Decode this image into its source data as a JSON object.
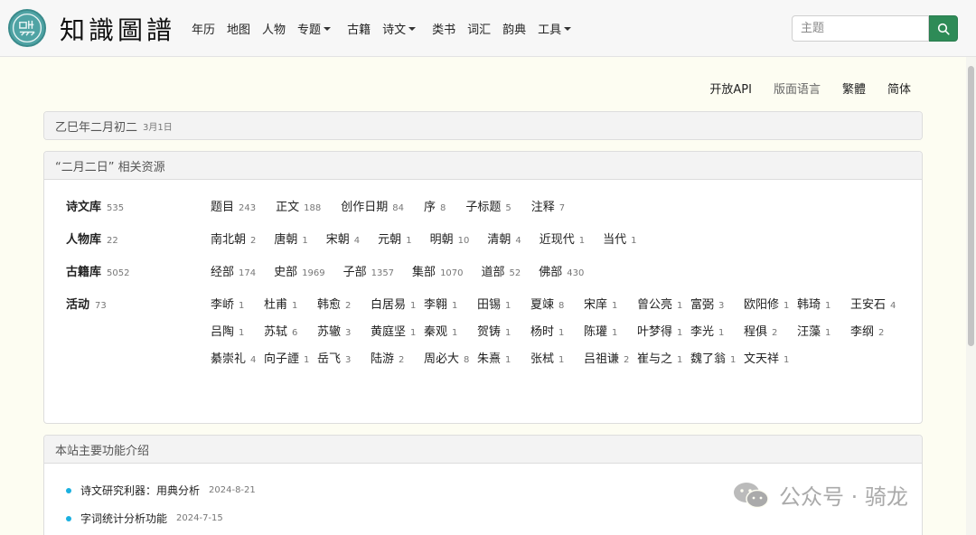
{
  "logo": {
    "text": "知識圖譜",
    "seal_text": "圖知識"
  },
  "nav": {
    "items": [
      {
        "label": "年历",
        "dropdown": false
      },
      {
        "label": "地图",
        "dropdown": false
      },
      {
        "label": "人物",
        "dropdown": false
      },
      {
        "label": "专题",
        "dropdown": true
      },
      {
        "label": "古籍",
        "dropdown": false
      },
      {
        "label": "诗文",
        "dropdown": true
      },
      {
        "label": "类书",
        "dropdown": false
      },
      {
        "label": "词汇",
        "dropdown": false
      },
      {
        "label": "韵典",
        "dropdown": false
      },
      {
        "label": "工具",
        "dropdown": true
      }
    ]
  },
  "search": {
    "placeholder": "主题"
  },
  "top_links": [
    {
      "label": "开放API",
      "muted": false
    },
    {
      "label": "版面语言",
      "muted": true
    },
    {
      "label": "繁體",
      "muted": false
    },
    {
      "label": "简体",
      "muted": false
    }
  ],
  "date_card": {
    "lunar": "乙巳年二月初二",
    "solar": "3月1日"
  },
  "resources": {
    "header": "“二月二日” 相关资源",
    "rows": [
      {
        "label": "诗文库",
        "count": "535",
        "items": [
          {
            "name": "题目",
            "count": "243"
          },
          {
            "name": "正文",
            "count": "188"
          },
          {
            "name": "创作日期",
            "count": "84"
          },
          {
            "name": "序",
            "count": "8"
          },
          {
            "name": "子标题",
            "count": "5"
          },
          {
            "name": "注释",
            "count": "7"
          }
        ]
      },
      {
        "label": "人物库",
        "count": "22",
        "items": [
          {
            "name": "南北朝",
            "count": "2"
          },
          {
            "name": "唐朝",
            "count": "1"
          },
          {
            "name": "宋朝",
            "count": "4"
          },
          {
            "name": "元朝",
            "count": "1"
          },
          {
            "name": "明朝",
            "count": "10"
          },
          {
            "name": "清朝",
            "count": "4"
          },
          {
            "name": "近现代",
            "count": "1"
          },
          {
            "name": "当代",
            "count": "1"
          }
        ]
      },
      {
        "label": "古籍库",
        "count": "5052",
        "items": [
          {
            "name": "经部",
            "count": "174"
          },
          {
            "name": "史部",
            "count": "1969"
          },
          {
            "name": "子部",
            "count": "1357"
          },
          {
            "name": "集部",
            "count": "1070"
          },
          {
            "name": "道部",
            "count": "52"
          },
          {
            "name": "佛部",
            "count": "430"
          }
        ]
      }
    ],
    "activity": {
      "label": "活动",
      "count": "73",
      "people": [
        {
          "name": "李峤",
          "count": "1"
        },
        {
          "name": "杜甫",
          "count": "1"
        },
        {
          "name": "韩愈",
          "count": "2"
        },
        {
          "name": "白居易",
          "count": "1"
        },
        {
          "name": "李翱",
          "count": "1"
        },
        {
          "name": "田锡",
          "count": "1"
        },
        {
          "name": "夏竦",
          "count": "8"
        },
        {
          "name": "宋庠",
          "count": "1"
        },
        {
          "name": "曾公亮",
          "count": "1"
        },
        {
          "name": "富弼",
          "count": "3"
        },
        {
          "name": "欧阳修",
          "count": "1"
        },
        {
          "name": "韩琦",
          "count": "1"
        },
        {
          "name": "王安石",
          "count": "4"
        },
        {
          "name": "吕陶",
          "count": "1"
        },
        {
          "name": "苏轼",
          "count": "6"
        },
        {
          "name": "苏辙",
          "count": "3"
        },
        {
          "name": "黄庭坚",
          "count": "1"
        },
        {
          "name": "秦观",
          "count": "1"
        },
        {
          "name": "贺铸",
          "count": "1"
        },
        {
          "name": "杨时",
          "count": "1"
        },
        {
          "name": "陈瓘",
          "count": "1"
        },
        {
          "name": "叶梦得",
          "count": "1"
        },
        {
          "name": "李光",
          "count": "1"
        },
        {
          "name": "程俱",
          "count": "2"
        },
        {
          "name": "汪藻",
          "count": "1"
        },
        {
          "name": "李纲",
          "count": "2"
        },
        {
          "name": "綦崇礼",
          "count": "4"
        },
        {
          "name": "向子諲",
          "count": "1"
        },
        {
          "name": "岳飞",
          "count": "3"
        },
        {
          "name": "陆游",
          "count": "2"
        },
        {
          "name": "周必大",
          "count": "8"
        },
        {
          "name": "朱熹",
          "count": "1"
        },
        {
          "name": "张栻",
          "count": "1"
        },
        {
          "name": "吕祖谦",
          "count": "2"
        },
        {
          "name": "崔与之",
          "count": "1"
        },
        {
          "name": "魏了翁",
          "count": "1"
        },
        {
          "name": "文天祥",
          "count": "1"
        }
      ]
    }
  },
  "intro": {
    "header": "本站主要功能介绍",
    "items": [
      {
        "title": "诗文研究利器：用典分析",
        "date": "2024-8-21"
      },
      {
        "title": "字词统计分析功能",
        "date": "2024-7-15"
      }
    ]
  },
  "watermark": {
    "text": "公众号 · 骑龙"
  }
}
